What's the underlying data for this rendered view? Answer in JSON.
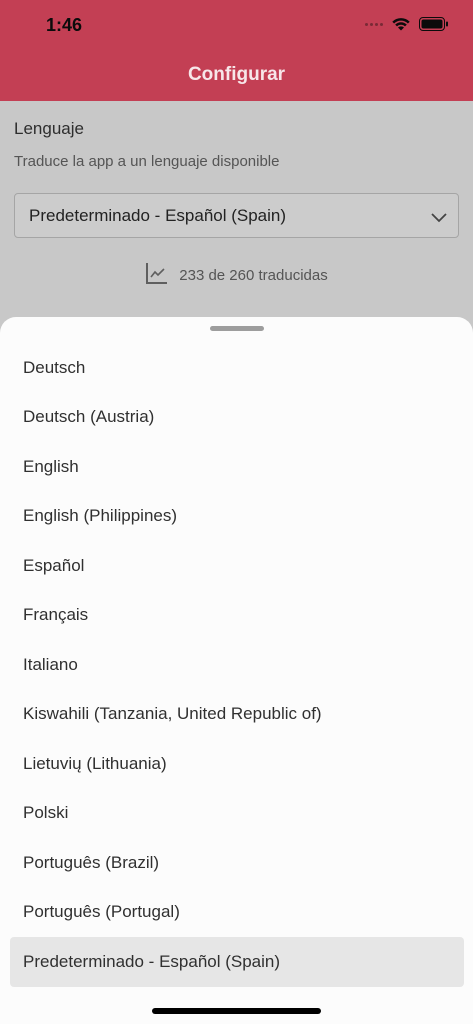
{
  "status_bar": {
    "time": "1:46"
  },
  "header": {
    "title": "Configurar"
  },
  "language_section": {
    "label": "Lenguaje",
    "description": "Traduce la app a un lenguaje disponible",
    "selected_value": "Predeterminado - Español (Spain)",
    "progress_text": "233 de 260 traducidas"
  },
  "options": [
    "Deutsch",
    "Deutsch (Austria)",
    "English",
    "English (Philippines)",
    "Español",
    "Français",
    "Italiano",
    "Kiswahili (Tanzania, United Republic of)",
    "Lietuvių (Lithuania)",
    "Polski",
    "Português (Brazil)",
    "Português (Portugal)",
    "Predeterminado - Español (Spain)"
  ],
  "selected_option_index": 12,
  "colors": {
    "accent": "#c33f54",
    "selected_row": "#e6e6e6"
  },
  "icons": [
    "signal-icon",
    "wifi-icon",
    "battery-icon",
    "chevron-down-icon",
    "chart-icon"
  ]
}
